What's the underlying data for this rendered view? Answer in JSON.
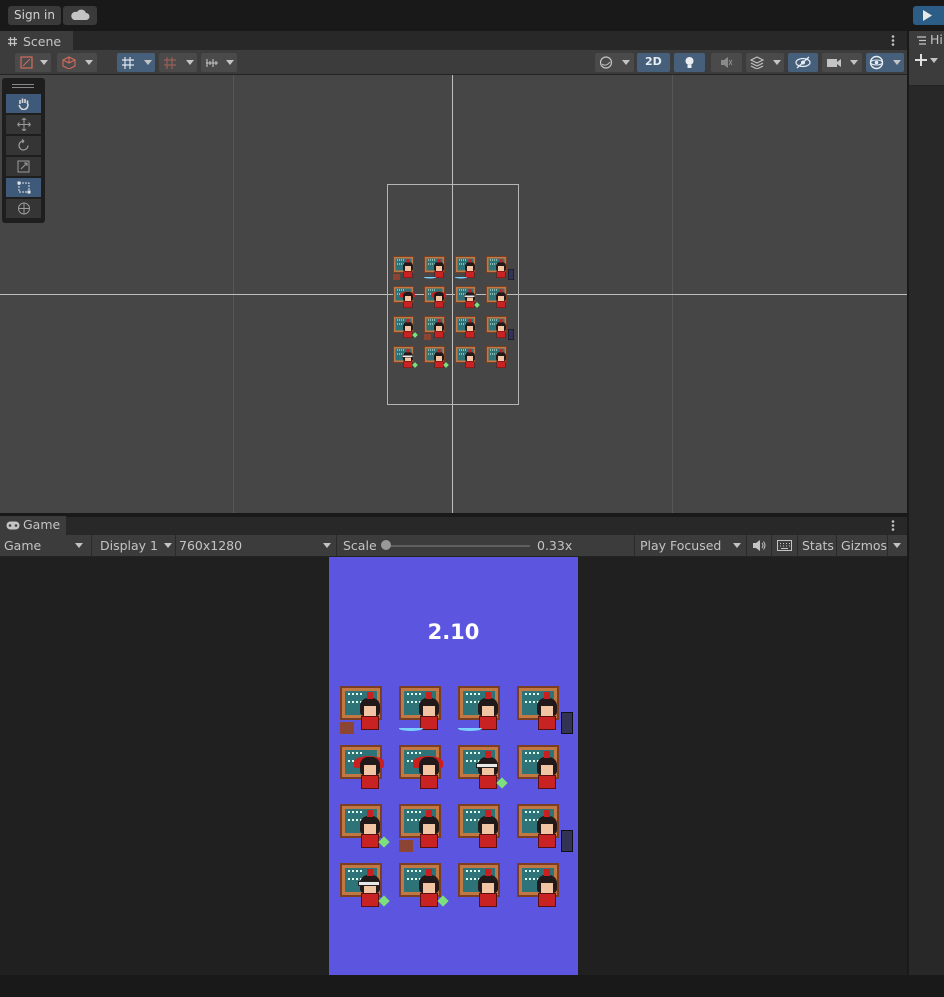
{
  "topbar": {
    "signin_label": "Sign in"
  },
  "scene": {
    "tab_label": "Scene",
    "mode_2d": "2D"
  },
  "hierarchy": {
    "tab_label": "Hi"
  },
  "game": {
    "tab_label": "Game",
    "view_select": "Game",
    "display_select": "Display 1",
    "resolution_select": "760x1280",
    "scale_label": "Scale",
    "scale_value": "0.33x",
    "scale_fraction": 0.0,
    "play_mode_select": "Play Focused",
    "stats_label": "Stats",
    "gizmos_label": "Gizmos",
    "timer_text": "2.10",
    "background_color": "#5b55df"
  },
  "grid": {
    "rows": [
      [
        "desk",
        "sword",
        "sword",
        "tv"
      ],
      [
        "crown",
        "crown",
        "goggle",
        "plain"
      ],
      [
        "gem",
        "desk",
        "plain",
        "tv"
      ],
      [
        "goggle",
        "gem",
        "plain",
        "plain"
      ]
    ]
  },
  "icons": {
    "cloud": "cloud-icon",
    "play": "play-icon",
    "hand": "hand-tool-icon",
    "move": "move-tool-icon",
    "rotate": "rotate-tool-icon",
    "scale": "scale-tool-icon",
    "rect": "rect-tool-icon",
    "transform": "transform-tool-icon",
    "audio": "audio-mute-icon",
    "keyboard": "keyboard-icon",
    "kebab": "more-menu-icon"
  }
}
